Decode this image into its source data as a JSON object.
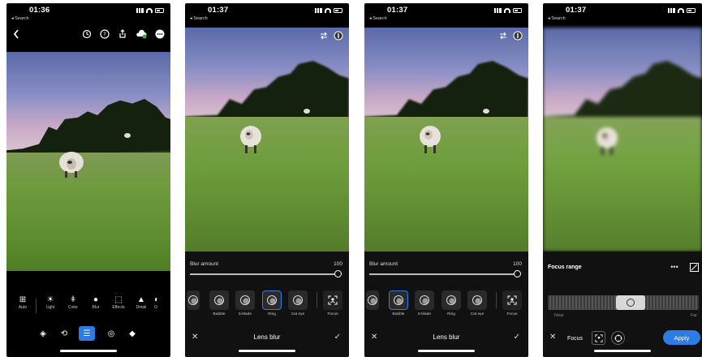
{
  "screens": [
    {
      "time": "01:36",
      "back_label": "◂ Search",
      "toolbar": [
        {
          "label": "Auto",
          "icon": "auto-icon",
          "glyph": "✨"
        },
        {
          "label": "Light",
          "icon": "sun-icon",
          "glyph": "☀"
        },
        {
          "label": "Color",
          "icon": "thermometer-icon",
          "glyph": "🌡"
        },
        {
          "label": "Blur",
          "icon": "drop-icon",
          "glyph": "💧"
        },
        {
          "label": "Effects",
          "icon": "effects-icon",
          "glyph": "⬚"
        },
        {
          "label": "Detail",
          "icon": "triangle-icon",
          "glyph": "▲"
        },
        {
          "label": "O",
          "icon": "optics-icon",
          "glyph": "◐"
        }
      ],
      "bottom_tools": [
        "presets-icon",
        "crop-icon",
        "edit-sliders-icon",
        "heal-icon",
        "eraser-icon"
      ]
    },
    {
      "time": "01:37",
      "back_label": "◂ Search",
      "blur_amount_label": "Blur amount",
      "blur_amount_value": "100",
      "presets": [
        "Bubble",
        "5-blade",
        "Ring",
        "Cat eye"
      ],
      "selected_preset": "Ring",
      "focus_label": "Focus",
      "title": "Lens blur"
    },
    {
      "time": "01:37",
      "back_label": "◂ Search",
      "blur_amount_label": "Blur amount",
      "blur_amount_value": "100",
      "presets": [
        "Bubble",
        "5-blade",
        "Ring",
        "Cat eye"
      ],
      "selected_preset": "Bubble",
      "focus_label": "Focus",
      "title": "Lens blur"
    },
    {
      "time": "01:37",
      "back_label": "◂ Search",
      "focus_range_label": "Focus range",
      "near_label": "Near",
      "far_label": "Far",
      "focus_label": "Focus",
      "apply_label": "Apply"
    }
  ],
  "colors": {
    "accent": "#2d7be5",
    "background": "#000000",
    "panel": "#111111"
  }
}
